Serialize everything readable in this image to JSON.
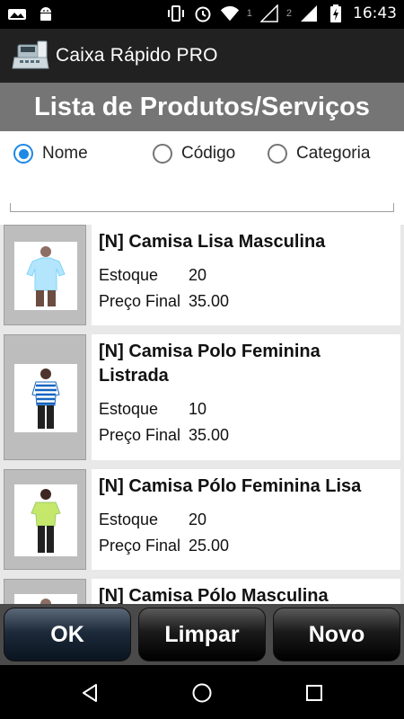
{
  "status_bar": {
    "time": "16:43",
    "sim1_label": "1",
    "sim2_label": "2",
    "icons": [
      "image-icon",
      "android-icon",
      "vibrate-icon",
      "alarm-icon",
      "wifi-icon",
      "signal-icon",
      "signal-icon",
      "battery-charging-icon"
    ]
  },
  "app": {
    "title": "Caixa Rápido PRO",
    "icon": "cash-register-icon"
  },
  "page": {
    "title": "Lista de Produtos/Serviços"
  },
  "filter": {
    "options": [
      {
        "label": "Nome",
        "checked": true
      },
      {
        "label": "Código",
        "checked": false
      },
      {
        "label": "Categoria",
        "checked": false
      }
    ],
    "search_value": ""
  },
  "products": [
    {
      "name": "[N] Camisa Lisa Masculina",
      "stock_label": "Estoque",
      "stock": "20",
      "price_label": "Preço Final",
      "price": "35.00",
      "image": "tshirt-male-icon"
    },
    {
      "name": "[N] Camisa Polo Feminina Listrada",
      "stock_label": "Estoque",
      "stock": "10",
      "price_label": "Preço Final",
      "price": "35.00",
      "image": "striped-shirt-female-icon"
    },
    {
      "name": "[N] Camisa Pólo Feminina Lisa",
      "stock_label": "Estoque",
      "stock": "20",
      "price_label": "Preço Final",
      "price": "25.00",
      "image": "polo-female-icon"
    },
    {
      "name": "[N] Camisa Pólo Masculina",
      "image": "polo-male-icon"
    }
  ],
  "buttons": {
    "ok": "OK",
    "clear": "Limpar",
    "new": "Novo"
  },
  "colors": {
    "accent": "#1e88e5",
    "action_bar": "#212121",
    "title_band": "#757575"
  }
}
